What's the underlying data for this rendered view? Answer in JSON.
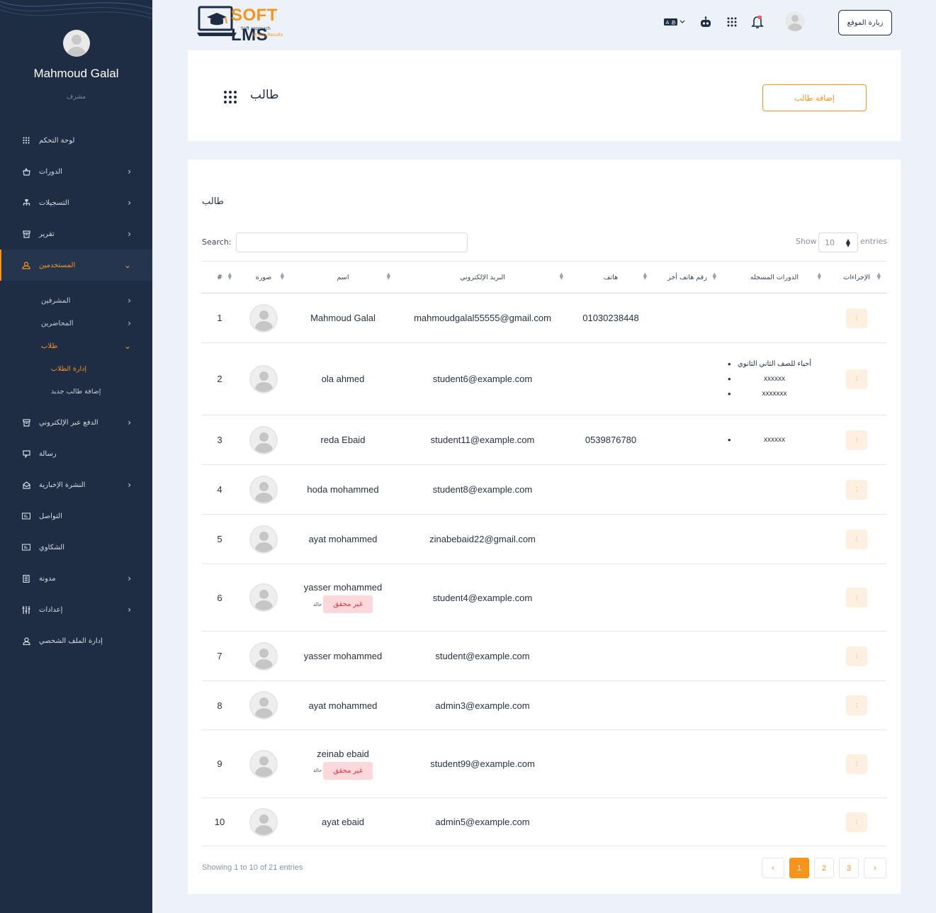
{
  "sidebar": {
    "profile": {
      "name": "Mahmoud Galal",
      "role": "مشرف"
    },
    "items": [
      {
        "label": "لوحة التحكم",
        "icon": "grid-icon"
      },
      {
        "label": "الدورات",
        "icon": "basket-icon"
      },
      {
        "label": "التسجيلات",
        "icon": "hierarchy-icon"
      },
      {
        "label": "تقرير",
        "icon": "archive-icon"
      },
      {
        "label": "المستخدمين",
        "icon": "users-icon"
      },
      {
        "label": "الدفع عبر الإلكتروني",
        "icon": "archive-icon"
      },
      {
        "label": "رسالة",
        "icon": "message-icon"
      },
      {
        "label": "النشرة الإخبارية",
        "icon": "mail-open-icon"
      },
      {
        "label": "التواصل",
        "icon": "contact-card-icon"
      },
      {
        "label": "الشكاوي",
        "icon": "contact-card-icon"
      },
      {
        "label": "مدونة",
        "icon": "document-icon"
      },
      {
        "label": "إعدادات",
        "icon": "sliders-icon"
      },
      {
        "label": "إدارة الملف الشخصي",
        "icon": "user-icon"
      }
    ],
    "users_sub": [
      {
        "label": "المشرفين"
      },
      {
        "label": "المحاضرين"
      },
      {
        "label": "طلاب"
      }
    ],
    "students_sub": [
      {
        "label": "إدارة الطلاب"
      },
      {
        "label": "إضافة طالب جديد"
      }
    ]
  },
  "topbar": {
    "logo_soft": "SOFT",
    "logo_lms": " LMS",
    "logo_tag": "Soft approach",
    "logo_tag2": "Strong Results",
    "visit_site": "زيارة الموقع"
  },
  "header": {
    "title": "طالب",
    "add_button": "إضافة طالب"
  },
  "table_card": {
    "title": "طالب",
    "search_label": "Search:",
    "search_value": "",
    "show_label": "Show",
    "show_value": "10",
    "entries_label": "entries",
    "columns": [
      "#",
      "صوره",
      "اسم",
      "البريد الإلكتروني",
      "هاتف",
      "رقم هاتف أخر",
      "الدورات المسجله",
      "الإجراءات"
    ],
    "rows": [
      {
        "idx": "1",
        "name": "Mahmoud Galal",
        "email": "mahmoudgalal55555@gmail.com",
        "phone": "01030238448",
        "courses": []
      },
      {
        "idx": "2",
        "name": "ola ahmed",
        "email": "student6@example.com",
        "phone": "",
        "courses": [
          "أحياء للصف الثاني الثانوي",
          "xxxxxx",
          "xxxxxxx"
        ]
      },
      {
        "idx": "3",
        "name": "reda Ebaid",
        "email": "student11@example.com",
        "phone": "0539876780",
        "courses": [
          "xxxxxx"
        ]
      },
      {
        "idx": "4",
        "name": "hoda mohammed",
        "email": "student8@example.com",
        "phone": "",
        "courses": []
      },
      {
        "idx": "5",
        "name": "ayat mohammed",
        "email": "zinabebaid22@gmail.com",
        "phone": "",
        "courses": []
      },
      {
        "idx": "6",
        "name": "yasser mohammed",
        "email": "student4@example.com",
        "phone": "",
        "courses": [],
        "badge": "غير محقق",
        "badge_note": "حالة"
      },
      {
        "idx": "7",
        "name": "yasser mohammed",
        "email": "student@example.com",
        "phone": "",
        "courses": []
      },
      {
        "idx": "8",
        "name": "ayat mohammed",
        "email": "admin3@example.com",
        "phone": "",
        "courses": []
      },
      {
        "idx": "9",
        "name": "zeinab ebaid",
        "email": "student99@example.com",
        "phone": "",
        "courses": [],
        "badge": "غير محقق",
        "badge_note": "حالة"
      },
      {
        "idx": "10",
        "name": "ayat ebaid",
        "email": "admin5@example.com",
        "phone": "",
        "courses": []
      }
    ],
    "action_glyph": "⋮",
    "footer_info": "Showing 1 to 10 of 21 entries",
    "pagination": {
      "prev": "‹",
      "pages": [
        "1",
        "2",
        "3"
      ],
      "current": "1",
      "next": "›"
    }
  },
  "colors": {
    "accent": "#f7941d",
    "sidebar_bg": "#1e2d44",
    "badge_bg": "#fbd8db",
    "badge_text": "#e5323e"
  }
}
